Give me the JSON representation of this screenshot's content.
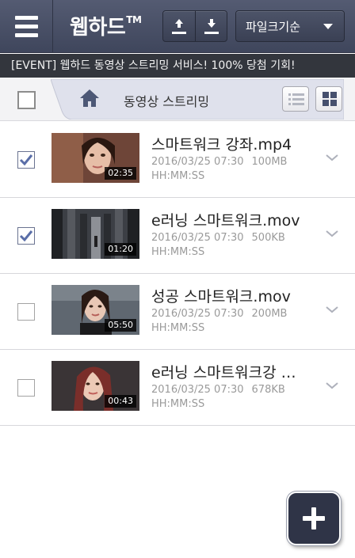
{
  "header": {
    "title": "웹하드",
    "title_mark": "TM",
    "sort_label": "파일크기순",
    "icons": [
      "menu-icon",
      "upload-icon",
      "download-icon",
      "caret-down-icon"
    ]
  },
  "banner": {
    "text": "[EVENT] 웹하드 동영상 스트리밍 서비스! 100% 당첨 기회!"
  },
  "breadcrumb": {
    "label": "동영상 스트리밍",
    "icons": [
      "home-icon",
      "list-view-icon",
      "grid-view-icon"
    ]
  },
  "files": [
    {
      "name": "스마트워크 강좌.mp4",
      "date": "2016/03/25 07:30",
      "size": "100MB",
      "time_format": "HH:MM:SS",
      "duration": "02:35",
      "checked": true
    },
    {
      "name": "e러닝 스마트워크.mov",
      "date": "2016/03/25 07:30",
      "size": "500KB",
      "time_format": "HH:MM:SS",
      "duration": "01:20",
      "checked": true
    },
    {
      "name": "성공 스마트워크.mov",
      "date": "2016/03/25 07:30",
      "size": "200MB",
      "time_format": "HH:MM:SS",
      "duration": "05:50",
      "checked": false
    },
    {
      "name": "e러닝 스마트워크강 …",
      "date": "2016/03/25 07:30",
      "size": "678KB",
      "time_format": "HH:MM:SS",
      "duration": "00:43",
      "checked": false
    }
  ],
  "fab": {
    "icon": "plus-icon"
  },
  "colors": {
    "header_bg": "#474e64",
    "banner_bg": "#33363d",
    "check_accent": "#5a6ea8",
    "fab_bg": "#2f3447"
  }
}
